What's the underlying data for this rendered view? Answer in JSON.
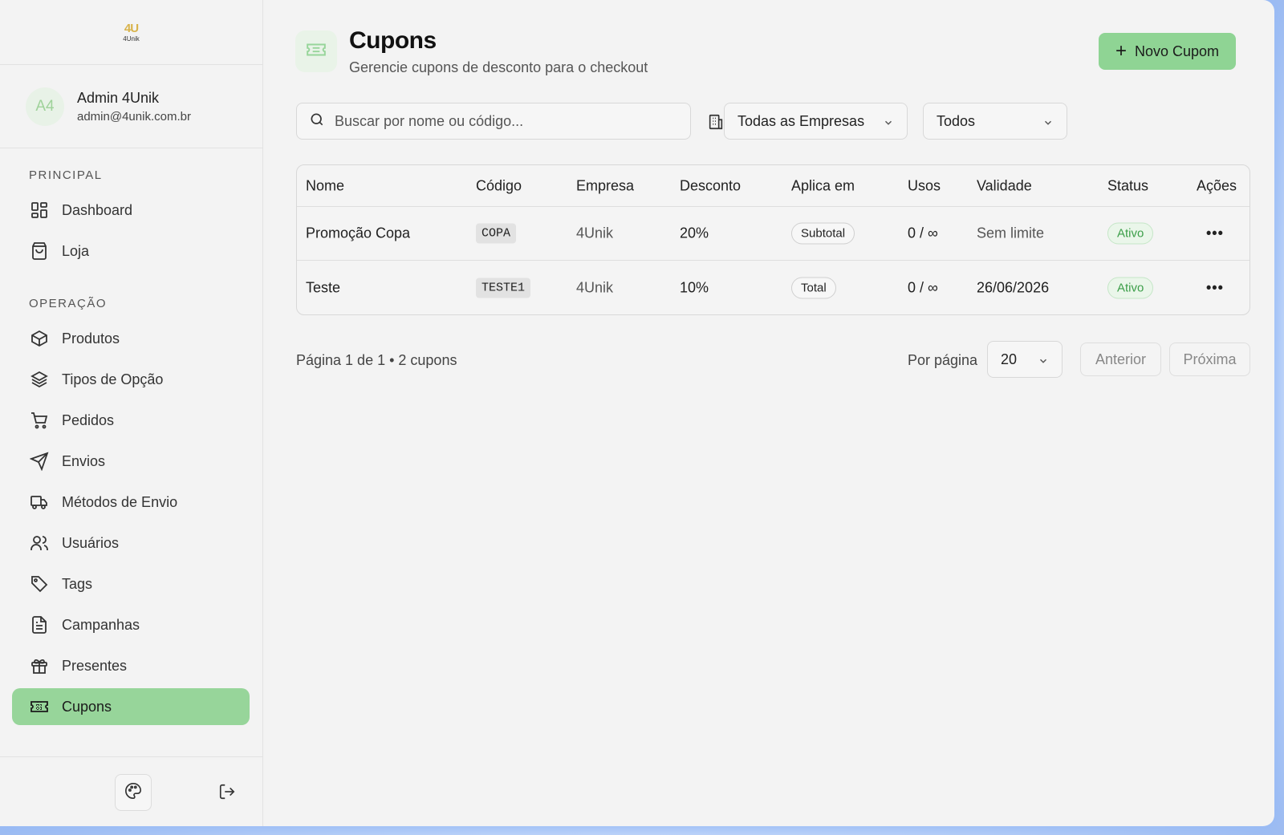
{
  "app": {
    "logo_mark": "4U",
    "logo_text": "4Unik"
  },
  "user": {
    "initials": "A4",
    "name": "Admin 4Unik",
    "email": "admin@4unik.com.br"
  },
  "sidebar": {
    "sections": [
      {
        "label": "PRINCIPAL",
        "items": [
          {
            "label": "Dashboard",
            "icon": "dashboard-icon"
          },
          {
            "label": "Loja",
            "icon": "shopping-bag-icon"
          }
        ]
      },
      {
        "label": "OPERAÇÃO",
        "items": [
          {
            "label": "Produtos",
            "icon": "box-icon"
          },
          {
            "label": "Tipos de Opção",
            "icon": "layers-icon"
          },
          {
            "label": "Pedidos",
            "icon": "cart-icon"
          },
          {
            "label": "Envios",
            "icon": "send-icon"
          },
          {
            "label": "Métodos de Envio",
            "icon": "truck-icon"
          },
          {
            "label": "Usuários",
            "icon": "users-icon"
          },
          {
            "label": "Tags",
            "icon": "tag-icon"
          },
          {
            "label": "Campanhas",
            "icon": "document-icon"
          },
          {
            "label": "Presentes",
            "icon": "gift-icon"
          },
          {
            "label": "Cupons",
            "icon": "ticket-icon",
            "active": true
          }
        ]
      }
    ]
  },
  "header": {
    "title": "Cupons",
    "subtitle": "Gerencie cupons de desconto para o checkout",
    "new_button_label": "Novo Cupom"
  },
  "filters": {
    "search_placeholder": "Buscar por nome ou código...",
    "company_select": "Todas as Empresas",
    "status_select": "Todos"
  },
  "table": {
    "columns": [
      "Nome",
      "Código",
      "Empresa",
      "Desconto",
      "Aplica em",
      "Usos",
      "Validade",
      "Status",
      "Ações"
    ],
    "rows": [
      {
        "name": "Promoção Copa",
        "code": "COPA",
        "company": "4Unik",
        "discount": "20%",
        "applies_to": "Subtotal",
        "uses": "0 / ∞",
        "validity": "Sem limite",
        "status": "Ativo",
        "actions": "•••"
      },
      {
        "name": "Teste",
        "code": "TESTE1",
        "company": "4Unik",
        "discount": "10%",
        "applies_to": "Total",
        "uses": "0 / ∞",
        "validity": "26/06/2026",
        "status": "Ativo",
        "actions": "•••"
      }
    ]
  },
  "pagination": {
    "info": "Página 1 de 1 • 2 cupons",
    "per_page_label": "Por página",
    "per_page_value": "20",
    "prev_label": "Anterior",
    "next_label": "Próxima"
  },
  "colors": {
    "accent": "#8fd494",
    "status_active": "#3b9e48",
    "background": "#f3f3f3"
  }
}
